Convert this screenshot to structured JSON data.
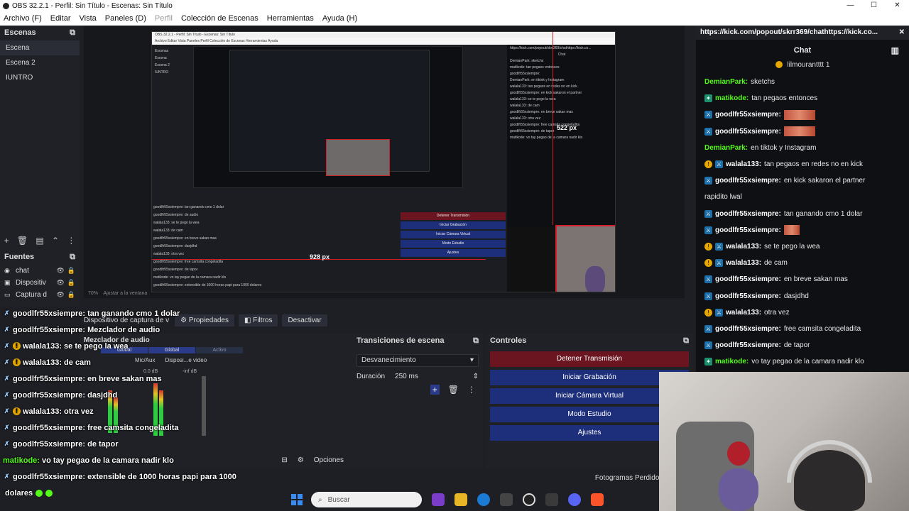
{
  "window": {
    "title": "OBS 32.2.1 - Perfil: Sin Título - Escenas: Sin Título",
    "btn_min": "—",
    "btn_max": "☐",
    "btn_close": "✕"
  },
  "menu": {
    "archivo": "Archivo (F)",
    "editar": "Editar",
    "vista": "Vista",
    "paneles": "Paneles (D)",
    "perfil": "Perfil",
    "coleccion": "Colección de Escenas",
    "herramientas": "Herramientas",
    "ayuda": "Ayuda (H)"
  },
  "scenes": {
    "title": "Escenas",
    "items": [
      "Escena",
      "Escena 2",
      "IUNTRO"
    ]
  },
  "sources": {
    "title": "Fuentes",
    "items": [
      "chat",
      "Dispositiv",
      "Captura d"
    ]
  },
  "preview": {
    "nested_title": "OBS 32.2.1 - Perfil: Sin Título - Escenas: Sin Título",
    "nested_menu": "Archivo  Editar  Vista  Paneles  Perfil  Colección de Escenas  Herramientas  Ayuda",
    "nested_scenes": [
      "Escenas",
      "Escena",
      "Escena 2",
      "IUNTRO"
    ],
    "nested_chat_header": "Chat",
    "nested_chat_url": "https://kick.com/popout/skrr369/chathttps://kick.co...",
    "nested_chat_lines": [
      "DemianPark: sketchs",
      "matikode: tan pegaos entonces",
      "goodlfr55xsiempre:",
      "DemianPark: en tiktok y Instagram",
      "walala133: tan pegaos en redes no en kick",
      "goodlfr55xsiempre: en kick sakaron el partner",
      "walala133: se te pego la wea",
      "walala133: de cam",
      "goodlfr55xsiempre: en breve sakan mas",
      "walala133: otra vez",
      "goodlfr55xsiempre: free camsita congeladita",
      "goodlfr55xsiempre: de tapor",
      "matikode: vo tay pegao de la camara nadir klo"
    ],
    "nested_controls": [
      "Detener Transmisión",
      "Iniciar Grabación",
      "Iniciar Cámara Virtual",
      "Modo Estudio",
      "Ajustes"
    ],
    "nested_lines": [
      "goodlfr55xsiempre: tan ganando cmo 1 dolar",
      "goodlfr55xsiempre: de audio",
      "walala133: se te pego la wea",
      "walala133: de cam",
      "goodlfr55xsiempre: en breve sakan mas",
      "goodlfr55xsiempre: dasjdhd",
      "walala133: otra vez",
      "goodlfr55xsiempre: free camsita congeladita",
      "goodlfr55xsiempre: de tapor",
      "matikode: vo tay pegao de la camara nadir klo",
      "goodlfr55xsiempre: extensible de 1000 horas papi para 1000 dolares"
    ],
    "px_label_1": "522 px",
    "px_label_2": "928 px",
    "px_label_3": "928 px",
    "zoom": "70%",
    "fit_label": "Ajustar a la ventana",
    "fotogramas": "Fotogramas Perdidos 0 (0.0%)"
  },
  "source_toolbar": {
    "source_name": "Dispositivo de captura de v",
    "properties": "Propiedades",
    "filters": "Filtros",
    "deactivate": "Desactivar"
  },
  "overlay_chat": [
    {
      "user": "goodlfr55xsiempre:",
      "msg": "tan ganando cmo 1 dolar",
      "badge": "sword"
    },
    {
      "user": "goodlfr55xsiempre:",
      "msg": "Mezclador de audio",
      "badge": "sword"
    },
    {
      "user": "walala133:",
      "msg": "se te pego la wea",
      "badge": "warn"
    },
    {
      "user": "walala133:",
      "msg": "de cam",
      "badge": "warn"
    },
    {
      "user": "goodlfr55xsiempre:",
      "msg": "en breve sakan mas",
      "badge": "sword"
    },
    {
      "user": "goodlfr55xsiempre:",
      "msg": "dasjdhd",
      "badge": "sword"
    },
    {
      "user": "walala133:",
      "msg": "otra vez",
      "badge": "warn"
    },
    {
      "user": "goodlfr55xsiempre:",
      "msg": "free camsita congeladita",
      "badge": "sword"
    },
    {
      "user": "goodlfr55xsiempre:",
      "msg": "de tapor",
      "badge": "sword"
    },
    {
      "user": "matikode:",
      "msg": "vo tay pegao de la camara nadir klo",
      "badge": "none"
    },
    {
      "user": "goodlfr55xsiempre:",
      "msg": "extensible de 1000 horas papi para 1000",
      "badge": "sword"
    },
    {
      "user": "",
      "msg": "dolares",
      "badge": "none"
    }
  ],
  "audio": {
    "title": "Mezclador de audio",
    "tab1": "Global",
    "tab2": "Global",
    "tab3": "Activo",
    "ch1": "Mic/Aux",
    "ch2": "Disposi...e video",
    "db1": "0.0 dB",
    "db2": "-inf dB",
    "options": "Opciones"
  },
  "transitions": {
    "title": "Transiciones de escena",
    "selected": "Desvanecimiento",
    "duration_label": "Duración",
    "duration_value": "250 ms"
  },
  "controls": {
    "title": "Controles",
    "stop_stream": "Detener Transmisión",
    "start_record": "Iniciar Grabación",
    "virtual_cam": "Iniciar Cámara Virtual",
    "studio_mode": "Modo Estudio",
    "settings": "Ajustes"
  },
  "status": {
    "dropped": "Fotogramas Perdidos 0 (0.0%)"
  },
  "taskbar": {
    "search_placeholder": "Buscar"
  },
  "chat": {
    "url": "https://kick.com/popout/skrr369/chathttps://kick.co...",
    "header": "Chat",
    "pinned_user": "lilmourantttt",
    "pinned_count": "1",
    "messages": [
      {
        "user": "DemianPark:",
        "msg": "sketchs",
        "badge": "none",
        "green": true
      },
      {
        "user": "matikode:",
        "msg": "tan pegaos entonces",
        "badge": "g",
        "green": true
      },
      {
        "user": "goodlfr55xsiempre:",
        "msg": "",
        "badge": "s",
        "green": false,
        "emote": "wide"
      },
      {
        "user": "goodlfr55xsiempre:",
        "msg": "",
        "badge": "s",
        "green": false,
        "emote": "wide"
      },
      {
        "user": "DemianPark:",
        "msg": "en tiktok y Instagram",
        "badge": "none",
        "green": true
      },
      {
        "user": "walala133:",
        "msg": "tan pegaos en redes no en kick",
        "badge": "w",
        "green": false
      },
      {
        "user": "goodlfr55xsiempre:",
        "msg": "en kick sakaron el partner",
        "badge": "s",
        "green": false
      },
      {
        "user": "",
        "msg": "rapidito lwal",
        "badge": "none",
        "green": false
      },
      {
        "user": "goodlfr55xsiempre:",
        "msg": "tan ganando cmo 1 dolar",
        "badge": "s",
        "green": false
      },
      {
        "user": "goodlfr55xsiempre:",
        "msg": "",
        "badge": "s",
        "green": false,
        "emote": "small"
      },
      {
        "user": "walala133:",
        "msg": "se te pego la wea",
        "badge": "w",
        "green": false
      },
      {
        "user": "walala133:",
        "msg": "de cam",
        "badge": "w",
        "green": false
      },
      {
        "user": "goodlfr55xsiempre:",
        "msg": "en breve sakan mas",
        "badge": "s",
        "green": false
      },
      {
        "user": "goodlfr55xsiempre:",
        "msg": "dasjdhd",
        "badge": "s",
        "green": false
      },
      {
        "user": "walala133:",
        "msg": "otra vez",
        "badge": "w",
        "green": false
      },
      {
        "user": "goodlfr55xsiempre:",
        "msg": "free camsita congeladita",
        "badge": "s",
        "green": false
      },
      {
        "user": "goodlfr55xsiempre:",
        "msg": "de tapor",
        "badge": "s",
        "green": false
      },
      {
        "user": "matikode:",
        "msg": "vo tay pegao de la camara nadir klo",
        "badge": "g",
        "green": true
      }
    ]
  },
  "colors": {
    "kick_green": "#53fc18",
    "stop_red": "#6b1520",
    "control_blue": "#1d2e7a",
    "selection_red": "#d41f2b"
  }
}
